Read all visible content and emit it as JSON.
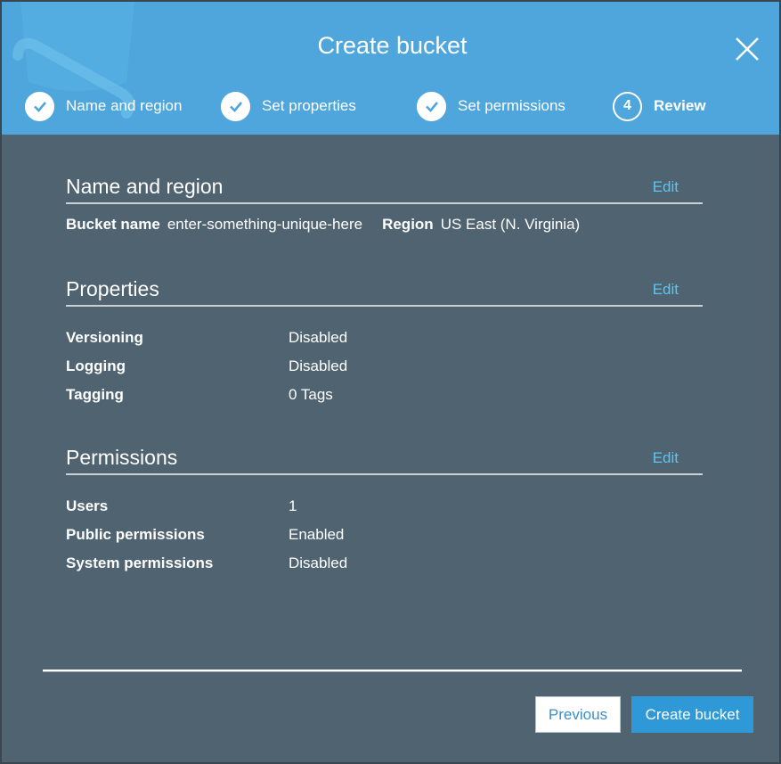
{
  "modal": {
    "title": "Create bucket"
  },
  "steps": [
    {
      "label": "Name and region",
      "status": "complete"
    },
    {
      "label": "Set properties",
      "status": "complete"
    },
    {
      "label": "Set permissions",
      "status": "complete"
    },
    {
      "label": "Review",
      "number": "4",
      "status": "active"
    }
  ],
  "name_region": {
    "title": "Name and region",
    "edit_label": "Edit",
    "bucket_name_key": "Bucket name",
    "bucket_name_value": "enter-something-unique-here",
    "region_key": "Region",
    "region_value": "US East (N. Virginia)"
  },
  "properties": {
    "title": "Properties",
    "edit_label": "Edit",
    "rows": [
      {
        "key": "Versioning",
        "value": "Disabled"
      },
      {
        "key": "Logging",
        "value": "Disabled"
      },
      {
        "key": "Tagging",
        "value": "0 Tags"
      }
    ]
  },
  "permissions": {
    "title": "Permissions",
    "edit_label": "Edit",
    "rows": [
      {
        "key": "Users",
        "value": "1"
      },
      {
        "key": "Public permissions",
        "value": "Enabled"
      },
      {
        "key": "System permissions",
        "value": "Disabled"
      }
    ]
  },
  "footer": {
    "previous_label": "Previous",
    "create_label": "Create bucket"
  },
  "colors": {
    "header": "#4ea6dd",
    "body": "#4f6371",
    "accent_link": "#5bc6f2",
    "primary_button": "#2e99d6"
  }
}
